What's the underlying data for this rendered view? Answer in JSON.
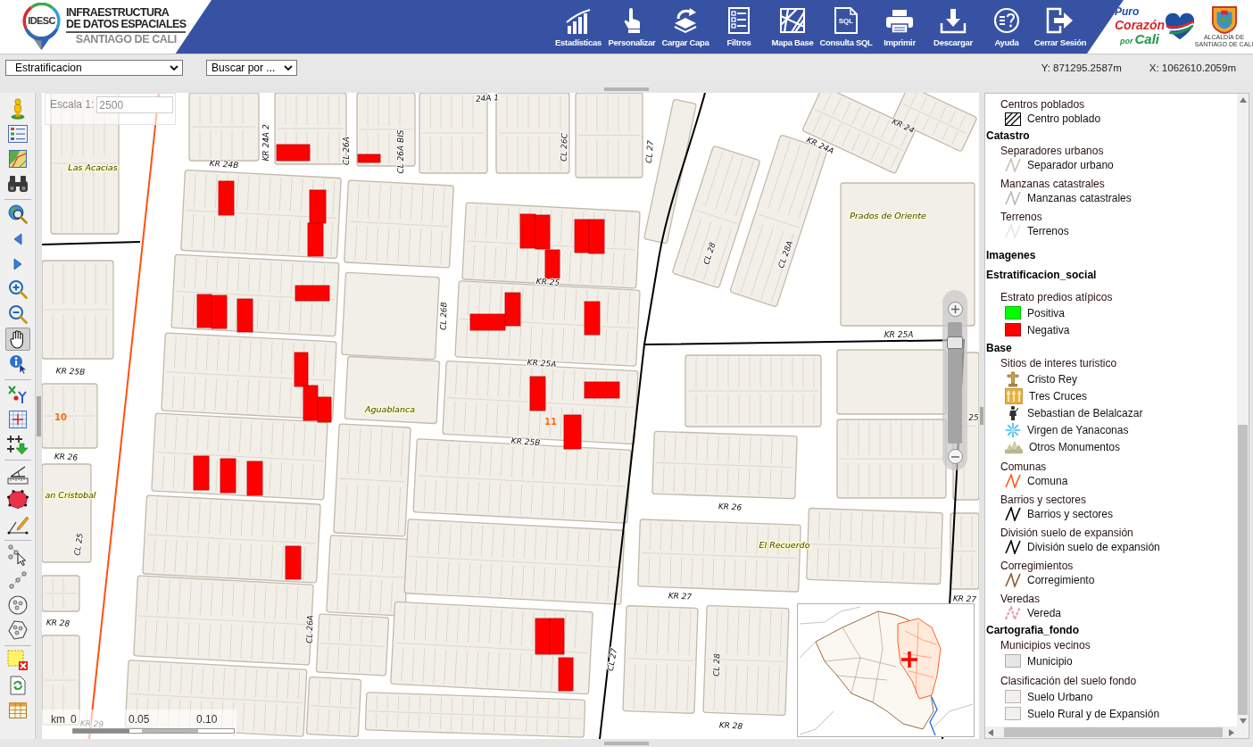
{
  "header": {
    "logo": {
      "badge": "IDESC",
      "lines": [
        "INFRAESTRUCTURA",
        "DE DATOS ESPACIALES",
        "SANTIAGO DE CALI"
      ]
    },
    "toolbar": [
      {
        "kind": "chart",
        "label": "Estadísticas"
      },
      {
        "kind": "pointer",
        "label": "Personalizar"
      },
      {
        "kind": "layers",
        "label": "Cargar Capa"
      },
      {
        "kind": "checklist",
        "label": "Filtros"
      },
      {
        "kind": "basemap",
        "label": "Mapa Base"
      },
      {
        "kind": "sql",
        "label": "Consulta SQL",
        "icon_text": "SQL"
      },
      {
        "kind": "print",
        "label": "Imprimir"
      },
      {
        "kind": "download",
        "label": "Descargar"
      },
      {
        "kind": "help",
        "label": "Ayuda"
      },
      {
        "kind": "logout",
        "label": "Cerrar Sesión"
      }
    ],
    "partner_logo": {
      "slogan": [
        "Puro",
        "Corazón",
        "por",
        "Cali"
      ],
      "seal_caption": [
        "ALCALDÍA DE",
        "SANTIAGO DE CALI"
      ]
    }
  },
  "filter_bar": {
    "layer_select": "Estratificacion",
    "search_select": "Buscar por ...",
    "coord_y": "Y: 871295.2587m",
    "coord_x": "X: 1062610.2059m"
  },
  "tools": [
    [
      {
        "kind": "person",
        "selected": false
      },
      {
        "kind": "legend",
        "selected": false
      },
      {
        "kind": "layers",
        "selected": false
      },
      {
        "kind": "binoculars",
        "selected": false
      }
    ],
    [
      {
        "kind": "extent",
        "selected": false
      },
      {
        "kind": "back",
        "selected": false
      },
      {
        "kind": "forward",
        "selected": false
      },
      {
        "kind": "zoomin",
        "selected": false
      },
      {
        "kind": "zoomout",
        "selected": false
      },
      {
        "kind": "pan",
        "selected": true
      },
      {
        "kind": "info",
        "selected": false
      }
    ],
    [
      {
        "kind": "coords",
        "selected": false
      },
      {
        "kind": "grid",
        "selected": false
      },
      {
        "kind": "points",
        "selected": false
      }
    ],
    [
      {
        "kind": "angle",
        "selected": false
      },
      {
        "kind": "area",
        "selected": false
      },
      {
        "kind": "distance",
        "selected": false
      }
    ],
    [
      {
        "kind": "pointer",
        "selected": false
      },
      {
        "kind": "lines",
        "selected": false
      },
      {
        "kind": "circle",
        "selected": false
      },
      {
        "kind": "polygon",
        "selected": false
      }
    ],
    [
      {
        "kind": "clear",
        "selected": false
      },
      {
        "kind": "refresh",
        "selected": false
      },
      {
        "kind": "table",
        "selected": false
      }
    ]
  ],
  "map": {
    "scale_label": "Escala 1:",
    "scale_value": "2500",
    "labels": [
      {
        "kind": "street",
        "text": "24A 1"
      },
      {
        "kind": "street",
        "text": "KR 24"
      },
      {
        "kind": "street",
        "text": "KR 24A 2"
      },
      {
        "kind": "street",
        "text": "CL 26A"
      },
      {
        "kind": "street",
        "text": "CL 26A BIS"
      },
      {
        "kind": "street",
        "text": "CL 26C"
      },
      {
        "kind": "street",
        "text": "KR 24A"
      },
      {
        "kind": "street",
        "text": "CL 27"
      },
      {
        "kind": "street",
        "text": "KR 24B"
      },
      {
        "kind": "neighborhood",
        "text": "Las Acacias"
      },
      {
        "kind": "neighborhood",
        "text": "Prados de Oriente"
      },
      {
        "kind": "street",
        "text": "CL 28"
      },
      {
        "kind": "street",
        "text": "CL 28A"
      },
      {
        "kind": "street",
        "text": "KR 25"
      },
      {
        "kind": "street",
        "text": "CL 26B"
      },
      {
        "kind": "street",
        "text": "KR 25A"
      },
      {
        "kind": "street",
        "text": "KR 25A"
      },
      {
        "kind": "street",
        "text": "KR 25B"
      },
      {
        "kind": "neighborhood",
        "text": "Aguablanca"
      },
      {
        "kind": "commune",
        "text": "10"
      },
      {
        "kind": "commune",
        "text": "11"
      },
      {
        "kind": "street",
        "text": "25"
      },
      {
        "kind": "street",
        "text": "KR 25B"
      },
      {
        "kind": "street",
        "text": "KR 26"
      },
      {
        "kind": "neighborhood",
        "text": "an Cristobal"
      },
      {
        "kind": "street",
        "text": "CL 25"
      },
      {
        "kind": "street",
        "text": "KR 26"
      },
      {
        "kind": "neighborhood",
        "text": "El Recuerdo"
      },
      {
        "kind": "street",
        "text": "KR 27"
      },
      {
        "kind": "street",
        "text": "KR 27"
      },
      {
        "kind": "street",
        "text": "KR 28"
      },
      {
        "kind": "street",
        "text": "CL 26A"
      },
      {
        "kind": "street",
        "text": "CL 27"
      },
      {
        "kind": "street",
        "text": "CL 28"
      },
      {
        "kind": "street",
        "text": "KR 28"
      },
      {
        "kind": "street",
        "text": "KR 29"
      }
    ],
    "zoom_slider": {
      "level": 0.87
    },
    "scale_bar": {
      "unit": "km",
      "ticks": [
        "0",
        "0.05",
        "0.10"
      ]
    }
  },
  "legend": {
    "groups": [
      {
        "layers": [
          {
            "title": "Centros poblados",
            "entries": [
              {
                "kind": "hatch",
                "label": "Centro poblado"
              }
            ]
          }
        ]
      },
      {
        "title": "Catastro",
        "layers": [
          {
            "title": "Separadores urbanos",
            "entries": [
              {
                "kind": "line",
                "color": "#c8c0b0",
                "label": "Separador urbano"
              }
            ]
          },
          {
            "title": "Manzanas catastrales",
            "entries": [
              {
                "kind": "line",
                "color": "#b8b8b8",
                "label": "Manzanas catastrales"
              }
            ]
          },
          {
            "title": "Terrenos",
            "entries": [
              {
                "kind": "line",
                "color": "#e6e6e6",
                "label": "Terrenos"
              }
            ]
          }
        ]
      },
      {
        "title": "Imagenes"
      },
      {
        "title": "Estratificacion_social",
        "layers": [
          {
            "title": "Estrato predios atípicos",
            "entries": [
              {
                "kind": "fill",
                "color": "#00ff00",
                "label": "Positiva"
              },
              {
                "kind": "fill",
                "color": "#ff0000",
                "label": "Negativa"
              }
            ]
          }
        ]
      },
      {
        "title": "Base",
        "layers": [
          {
            "title": "Sitios de interes turistico",
            "entries": [
              {
                "kind": "cross",
                "label": "Cristo Rey"
              },
              {
                "kind": "crosses",
                "label": "Tres Cruces"
              },
              {
                "kind": "statue",
                "label": "Sebastian de Belalcazar"
              },
              {
                "kind": "star",
                "label": "Virgen de Yanaconas"
              },
              {
                "kind": "monuments",
                "label": "Otros Monumentos"
              }
            ]
          },
          {
            "title": "Comunas",
            "entries": [
              {
                "kind": "line",
                "color": "#ff5a1a",
                "label": "Comuna"
              }
            ]
          },
          {
            "title": "Barrios y sectores",
            "entries": [
              {
                "kind": "line",
                "color": "#000000",
                "label": "Barrios y sectores"
              }
            ]
          },
          {
            "title": "División suelo de expansión",
            "entries": [
              {
                "kind": "line",
                "color": "#000000",
                "label": "División suelo de expansión"
              }
            ]
          },
          {
            "title": "Corregimientos",
            "entries": [
              {
                "kind": "line",
                "color": "#8b5a2b",
                "label": "Corregimiento"
              }
            ]
          },
          {
            "title": "Veredas",
            "entries": [
              {
                "kind": "dashed",
                "color": "#e8a0b0",
                "label": "Vereda"
              }
            ]
          }
        ]
      },
      {
        "title": "Cartografia_fondo",
        "layers": [
          {
            "title": "Municipios vecinos",
            "entries": [
              {
                "kind": "fill",
                "color": "#e6e6e6",
                "label": "Municipio"
              }
            ]
          },
          {
            "title": "Clasificación del suelo fondo",
            "entries": [
              {
                "kind": "fill",
                "color": "#f2f0ec",
                "label": "Suelo Urbano"
              },
              {
                "kind": "fill",
                "color": "#f2f0ec",
                "label": "Suelo Rural y de Expansión"
              }
            ]
          }
        ]
      }
    ]
  }
}
